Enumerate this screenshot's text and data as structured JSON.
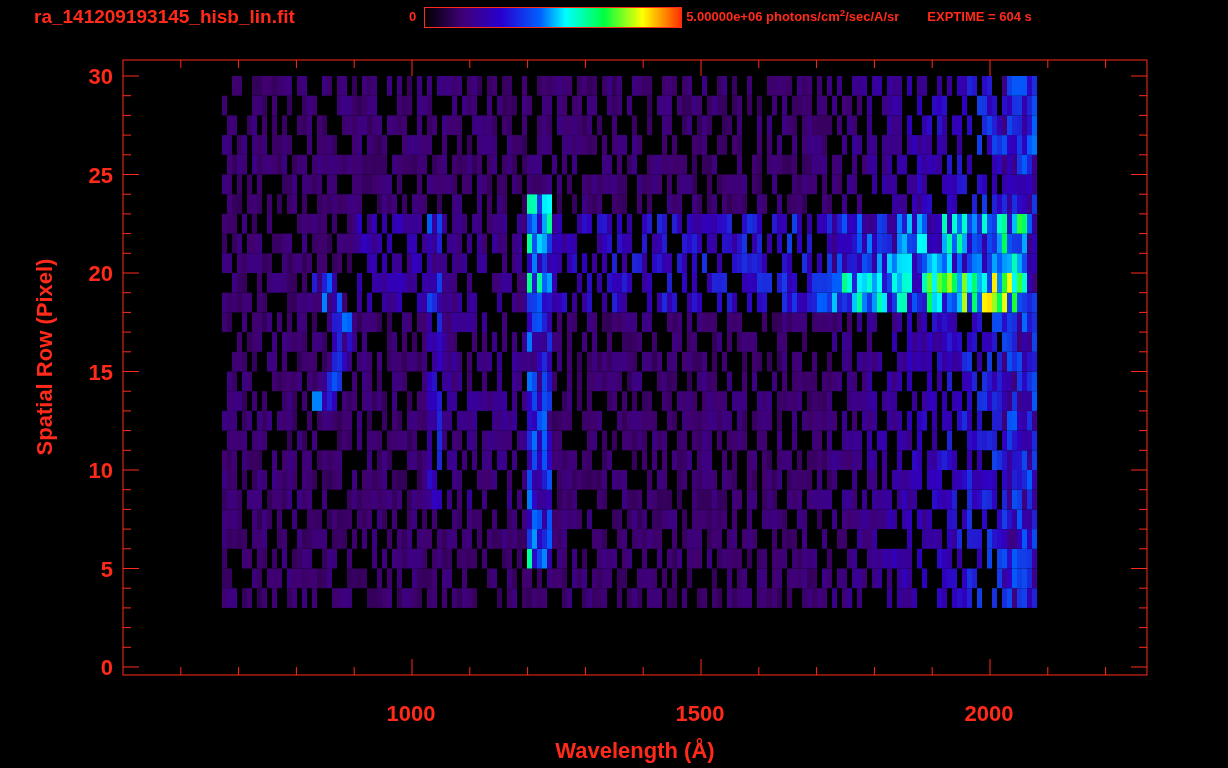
{
  "header": {
    "filename": "ra_141209193145_hisb_lin.fit",
    "colorbar": {
      "min_label": "0",
      "max_label": "5.00000e+06 photons/cm$^{2}$/sec/A/sr"
    },
    "exposure": "EXPTIME = 604 s"
  },
  "plot": {
    "xlabel": "Wavelength (Å)",
    "ylabel": "Spatial Row (Pixel)",
    "xtick_labels": [
      "1000",
      "1500",
      "2000"
    ],
    "ytick_labels": [
      "30",
      "25",
      "20",
      "15",
      "10",
      "5",
      "0"
    ]
  }
}
